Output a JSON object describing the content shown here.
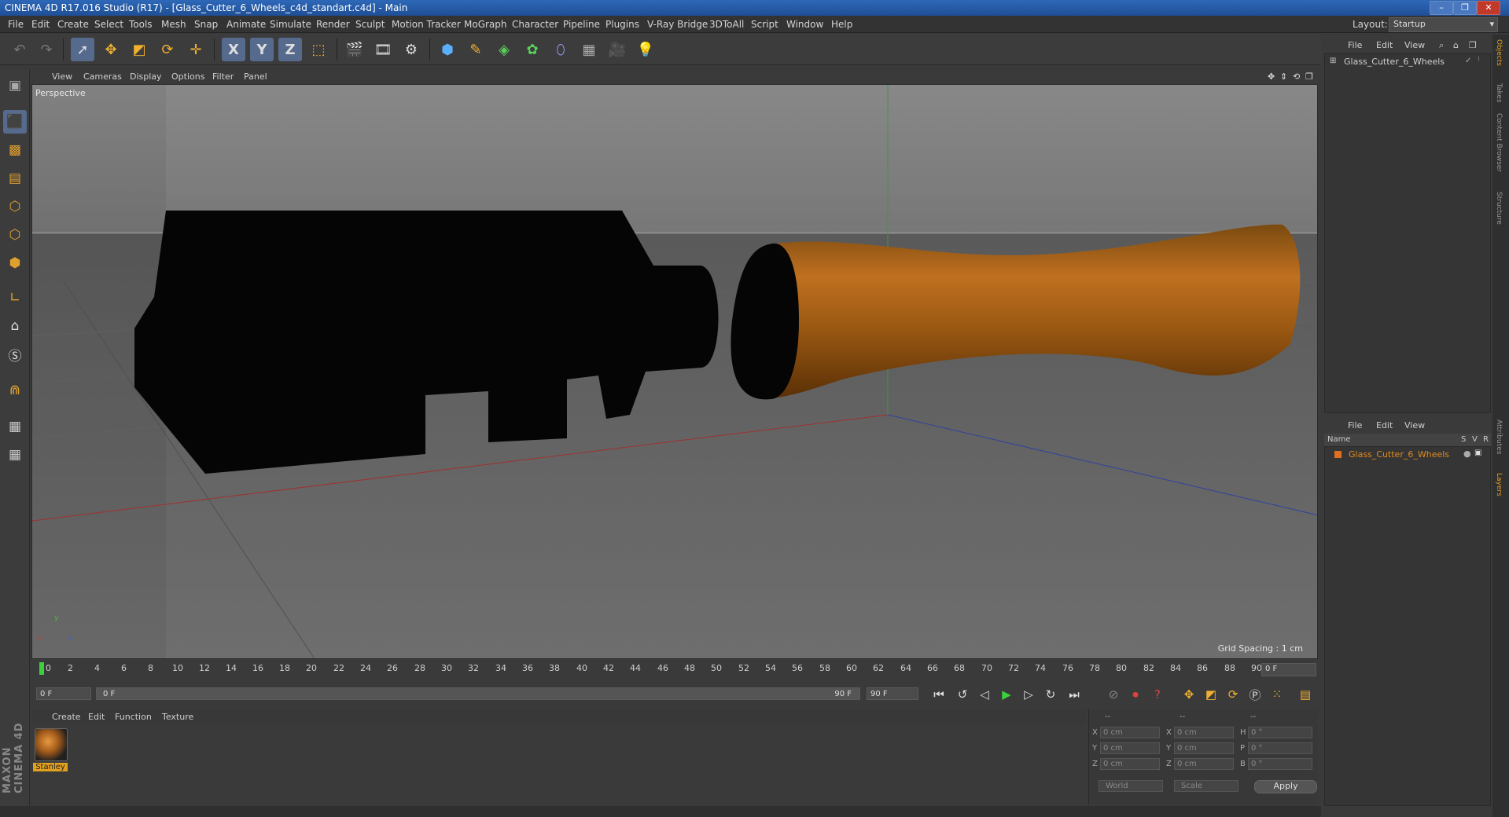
{
  "window": {
    "title": "CINEMA 4D R17.016 Studio (R17) - [Glass_Cutter_6_Wheels_c4d_standart.c4d] - Main",
    "buttons": [
      "–",
      "❐",
      "✕"
    ]
  },
  "menubar": {
    "items": [
      "File",
      "Edit",
      "Create",
      "Select",
      "Tools",
      "Mesh",
      "Snap",
      "Animate",
      "Simulate",
      "Render",
      "Sculpt",
      "Motion Tracker",
      "MoGraph",
      "Character",
      "Pipeline",
      "Plugins",
      "V-Ray Bridge",
      "3DToAll",
      "Script",
      "Window",
      "Help"
    ],
    "layout_label": "Layout:",
    "layout_value": "Startup"
  },
  "toolbar": {
    "axis_x": "X",
    "axis_y": "Y",
    "axis_z": "Z"
  },
  "viewport": {
    "menu": [
      "View",
      "Cameras",
      "Display",
      "Options",
      "Filter",
      "Panel"
    ],
    "label": "Perspective",
    "grid_spacing": "Grid Spacing : 1 cm",
    "axis_x": "x",
    "axis_y": "y",
    "axis_z": "z"
  },
  "timeline": {
    "ticks": [
      "0",
      "2",
      "4",
      "6",
      "8",
      "10",
      "12",
      "14",
      "16",
      "18",
      "20",
      "22",
      "24",
      "26",
      "28",
      "30",
      "32",
      "34",
      "36",
      "38",
      "40",
      "42",
      "44",
      "46",
      "48",
      "50",
      "52",
      "54",
      "56",
      "58",
      "60",
      "62",
      "64",
      "66",
      "68",
      "70",
      "72",
      "74",
      "76",
      "78",
      "80",
      "82",
      "84",
      "86",
      "88",
      "90"
    ],
    "current_frame": "0 F"
  },
  "transport": {
    "start_field": "0 F",
    "range_start": "0 F",
    "range_end": "90 F",
    "end_field": "90 F"
  },
  "material_manager": {
    "menu": [
      "Create",
      "Edit",
      "Function",
      "Texture"
    ],
    "material_name": "Stanley"
  },
  "coordinates": {
    "headers": [
      "--",
      "--",
      "--"
    ],
    "rows": [
      {
        "a1": "X",
        "v1": "0 cm",
        "a2": "X",
        "v2": "0 cm",
        "a3": "H",
        "v3": "0 °"
      },
      {
        "a1": "Y",
        "v1": "0 cm",
        "a2": "Y",
        "v2": "0 cm",
        "a3": "P",
        "v3": "0 °"
      },
      {
        "a1": "Z",
        "v1": "0 cm",
        "a2": "Z",
        "v2": "0 cm",
        "a3": "B",
        "v3": "0 °"
      }
    ],
    "world_select": "World",
    "scale_select": "Scale",
    "apply": "Apply"
  },
  "object_manager": {
    "menu": [
      "File",
      "Edit",
      "View"
    ],
    "object_name": "Glass_Cutter_6_Wheels"
  },
  "layer_manager": {
    "menu": [
      "File",
      "Edit",
      "View"
    ],
    "col_name": "Name",
    "col_s": "S",
    "col_v": "V",
    "col_r": "R",
    "object_name": "Glass_Cutter_6_Wheels",
    "accent": "#e07020"
  },
  "side_tabs": [
    "Objects",
    "Takes",
    "Content Browser",
    "Structure",
    "Attributes",
    "Layers"
  ],
  "logo": {
    "line1": "MAXON",
    "line2": "CINEMA 4D"
  }
}
